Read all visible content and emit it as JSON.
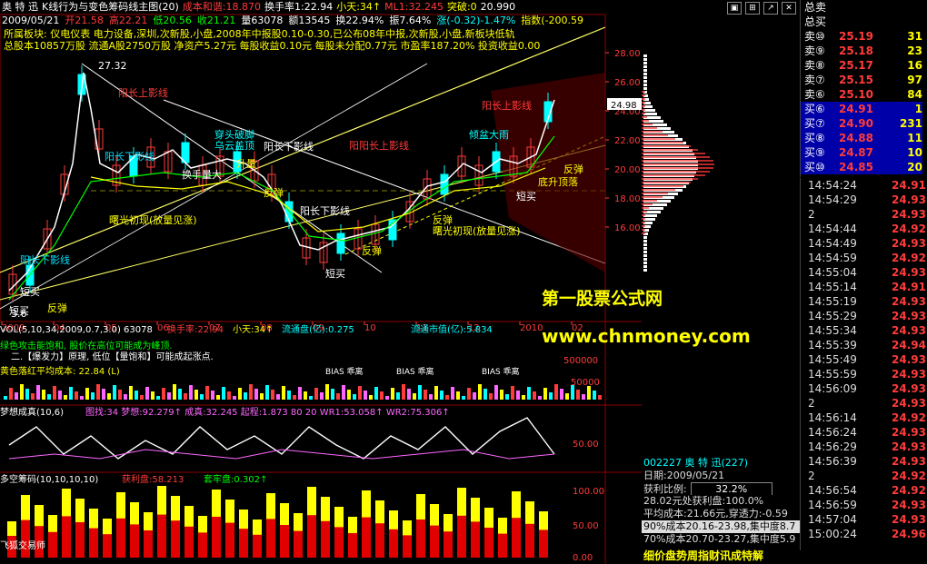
{
  "header": {
    "name": "奥 特 迅",
    "chart_title": "K线行为与变色筹码线主图(20)",
    "cost_label": "成本和谐:18.870",
    "turnover": "换手率1:22.94",
    "xiaotian": "小天:34↑",
    "ml": "ML1:32.245",
    "breakout": "突破:0",
    "price_last": "20.990",
    "date": "2009/05/21",
    "open": "开21.58",
    "high": "高22.21",
    "low": "低20.56",
    "close": "收21.21",
    "vol": "量63078",
    "amount": "额13545",
    "turnover2": "换22.94%",
    "amplitude": "振7.64%",
    "change": "涨(-0.32)-1.47%",
    "index": "指数(-200.59",
    "sector_line": "所属板块: 仪电仪表 电力设备,深圳,次新股,小盘,2008年中报股0.10-0.30,已公布08年中报,次新股,小盘,新板块低轨",
    "fin_line": "总股本10857万股  流通A股2750万股  净资产5.27元  每股收益0.10元  每股未分配0.77元  市盈率187.20%  投资收益0.00"
  },
  "toolbar": {
    "total_label": "总卖",
    "total_buy": "总买"
  },
  "order_book": {
    "sells": [
      {
        "label": "卖⑩",
        "price": "25.19",
        "qty": "31"
      },
      {
        "label": "卖⑨",
        "price": "25.18",
        "qty": "23"
      },
      {
        "label": "卖⑧",
        "price": "25.17",
        "qty": "16"
      },
      {
        "label": "卖⑦",
        "price": "25.15",
        "qty": "97"
      },
      {
        "label": "卖⑥",
        "price": "25.10",
        "qty": "84"
      }
    ],
    "buys": [
      {
        "label": "买⑥",
        "price": "24.91",
        "qty": "1"
      },
      {
        "label": "买⑦",
        "price": "24.90",
        "qty": "231"
      },
      {
        "label": "买⑧",
        "price": "24.88",
        "qty": "11"
      },
      {
        "label": "买⑨",
        "price": "24.87",
        "qty": "10"
      },
      {
        "label": "买⑩",
        "price": "24.85",
        "qty": "20"
      }
    ]
  },
  "ticks": [
    {
      "t": "14:54:24",
      "p": "24.91"
    },
    {
      "t": "14:54:29",
      "p": "24.93"
    },
    {
      "t": "2",
      "p": "24.93"
    },
    {
      "t": "14:54:44",
      "p": "24.92"
    },
    {
      "t": "14:54:49",
      "p": "24.93"
    },
    {
      "t": "14:54:59",
      "p": "24.92"
    },
    {
      "t": "14:55:04",
      "p": "24.93"
    },
    {
      "t": "14:55:14",
      "p": "24.91"
    },
    {
      "t": "14:55:19",
      "p": "24.93"
    },
    {
      "t": "14:55:29",
      "p": "24.93"
    },
    {
      "t": "14:55:34",
      "p": "24.93"
    },
    {
      "t": "14:55:39",
      "p": "24.94"
    },
    {
      "t": "14:55:49",
      "p": "24.93"
    },
    {
      "t": "14:55:59",
      "p": "24.93"
    },
    {
      "t": "14:56:09",
      "p": "24.93"
    },
    {
      "t": "2",
      "p": "24.93"
    },
    {
      "t": "14:56:14",
      "p": "24.92"
    },
    {
      "t": "14:56:24",
      "p": "24.93"
    },
    {
      "t": "14:56:29",
      "p": "24.93"
    },
    {
      "t": "14:56:39",
      "p": "24.93"
    },
    {
      "t": "2",
      "p": "24.92"
    },
    {
      "t": "14:56:54",
      "p": "24.92"
    },
    {
      "t": "14:56:59",
      "p": "24.93"
    },
    {
      "t": "14:57:04",
      "p": "24.93"
    },
    {
      "t": "15:00:24",
      "p": "24.96"
    }
  ],
  "info": {
    "code_line": "002227 奥 特 迅(227)",
    "date_line": "日期:2009/05/21",
    "profit_label": "获利比例:",
    "profit_value": "32.2%",
    "line1": "28.02元处获利盘:100.0%",
    "line2": "平均成本:21.66元,穿透力:-0.59",
    "line3": "90%成本20.16-23.98,集中度8.7",
    "line4": "70%成本20.70-23.27,集中度5.9"
  },
  "bottom_tabs": "细价盘势周指财讯成特解",
  "watermark": {
    "line1": "第一股票公式网",
    "line2": "www.chnmoney.com"
  },
  "price_axis": [
    "28.00",
    "26.00",
    "24.00",
    "22.00",
    "20.00",
    "18.00",
    "16.00"
  ],
  "current_price_tag": "24.98",
  "month_axis": [
    "2009",
    "04",
    "05",
    "06",
    "07",
    "08",
    "09",
    "10",
    "11",
    "12",
    "2010",
    "02"
  ],
  "vol_header": "VOL(5,10,34,2009,0.7,3.0) 63078",
  "vol_turnover": "换手率:22.94",
  "vol_xiaotian": "小天:34↑",
  "vol_liutong": "流通盘(亿):0.275",
  "vol_mktval": "流通市值(亿):5.834",
  "vol_axis": [
    "500000",
    "50000"
  ],
  "dream_header": "梦想成真(10,6)",
  "dream_values": "图找:34  梦想:92.279↑  成真:32.245  起程:1.873  80 20  WR1:53.058↑  WR2:75.306↑",
  "dream_axis": [
    "50.00"
  ],
  "chip_header": "多空筹码(10,10,10,10)",
  "chip_profit": "获利盘:58.213",
  "chip_trap": "套牢盘:0.302↑",
  "chip_axis": [
    "100.00",
    "50.00",
    "0.00"
  ],
  "chip_footer": "飞狐交易师",
  "annotations": [
    {
      "t": "阳长上影线",
      "c": "#ff3b3b"
    },
    {
      "t": "阳长下影线",
      "c": "#00e0ff"
    },
    {
      "t": "短买",
      "c": "#fff"
    },
    {
      "t": "反弹",
      "c": "#ffff00"
    },
    {
      "t": "穿头破脚",
      "c": "#00ffff"
    },
    {
      "t": "乌云盖顶",
      "c": "#00ffff"
    },
    {
      "t": "曙光初现(放量见涨)",
      "c": "#ffff00"
    },
    {
      "t": "倾盆大雨",
      "c": "#00ffff"
    },
    {
      "t": "阳长上影线",
      "c": "#ff3b3b"
    }
  ],
  "vol_notes": [
    "绿色攻击能饱和, 股价在高位可能成为峰顶.",
    "二.【爆发力】原理, 低位【量饱和】可能成起涨点.",
    "黄色落红平均成本: 22.84 (L)"
  ],
  "bias_labels": [
    "BIAS 乖离",
    "BIAS 乖离",
    "BIAS 乖离"
  ]
}
